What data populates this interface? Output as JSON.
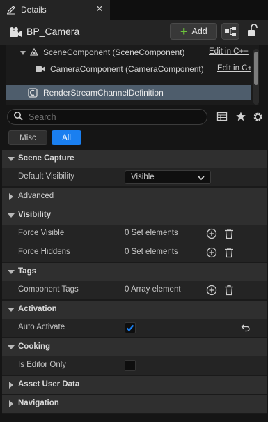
{
  "tab": {
    "label": "Details"
  },
  "header": {
    "actor_name": "BP_Camera",
    "add_label": "Add"
  },
  "tree": {
    "items": [
      {
        "label": "SceneComponent (SceneComponent)",
        "edit": "Edit in C++"
      },
      {
        "label": "CameraComponent (CameraComponent)",
        "edit": "Edit in C+"
      },
      {
        "label": "RenderStreamChannelDefinition",
        "edit": ""
      }
    ]
  },
  "search": {
    "placeholder": "Search"
  },
  "filters": {
    "misc": "Misc",
    "all": "All"
  },
  "categories": {
    "scene_capture": "Scene Capture",
    "advanced": "Advanced",
    "visibility": "Visibility",
    "tags": "Tags",
    "activation": "Activation",
    "cooking": "Cooking",
    "asset_user_data": "Asset User Data",
    "navigation": "Navigation"
  },
  "props": {
    "default_visibility": {
      "label": "Default Visibility",
      "value": "Visible"
    },
    "force_visible": {
      "label": "Force Visible",
      "value": "0 Set elements"
    },
    "force_hiddens": {
      "label": "Force Hiddens",
      "value": "0 Set elements"
    },
    "component_tags": {
      "label": "Component Tags",
      "value": "0 Array element"
    },
    "auto_activate": {
      "label": "Auto Activate",
      "checked": true
    },
    "is_editor_only": {
      "label": "Is Editor Only",
      "checked": false
    }
  },
  "colors": {
    "accent": "#1a7ff0",
    "add_plus": "#6cc43b",
    "selected_row": "#4e5d6c"
  }
}
